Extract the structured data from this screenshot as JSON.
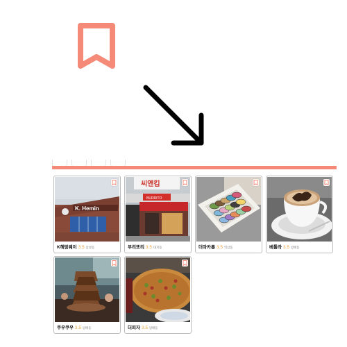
{
  "colors": {
    "accent": "#f58a78",
    "rating": "#f2a23a"
  },
  "icons": {
    "hero_bookmark": "bookmark-icon",
    "arrow": "arrow-down-right-icon",
    "card_bookmark": "bookmark-icon"
  },
  "filters": [
    "",
    "",
    "",
    ""
  ],
  "places": [
    {
      "name": "K헤밍웨이",
      "rating": "3.5",
      "location": "삼성동"
    },
    {
      "name": "부리또리",
      "rating": "3.5",
      "location": "대치동"
    },
    {
      "name": "더마카롱",
      "rating": "3.5",
      "location": "역삼동"
    },
    {
      "name": "베톨라",
      "rating": "3.5",
      "location": "방배동"
    },
    {
      "name": "쿠우쿠우",
      "rating": "3.5",
      "location": "방배동"
    },
    {
      "name": "더피자",
      "rating": "3.5",
      "location": "방배동"
    }
  ]
}
